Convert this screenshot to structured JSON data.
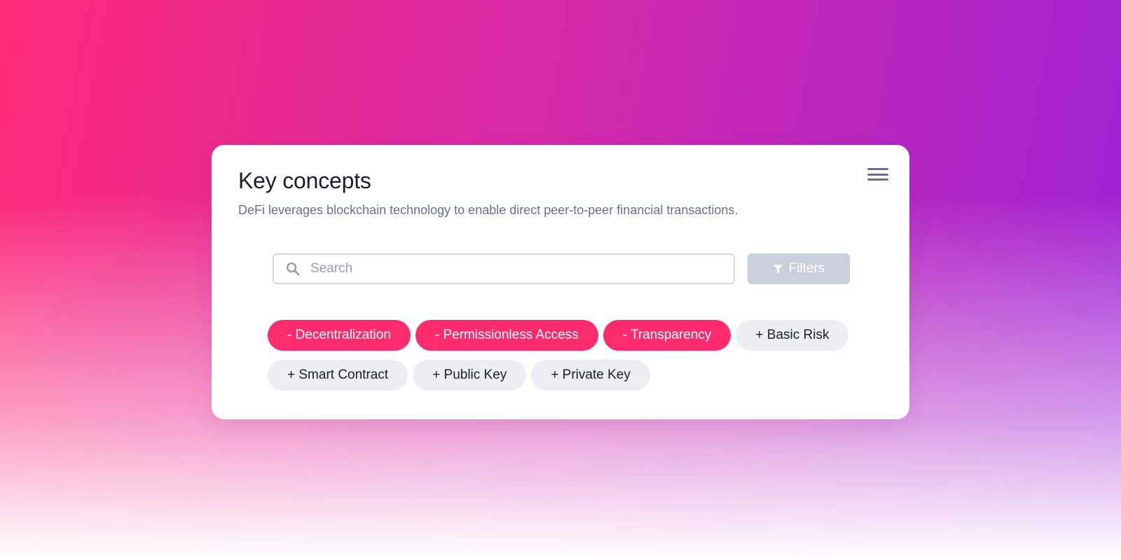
{
  "card": {
    "title": "Key concepts",
    "description": "DeFi leverages blockchain technology to enable direct peer-to-peer financial transactions.",
    "menu_icon": "hamburger-menu-icon"
  },
  "search": {
    "placeholder": "Search",
    "value": "",
    "icon": "search-icon"
  },
  "filters": {
    "label": "Filters",
    "icon": "filter-icon",
    "state": "disabled"
  },
  "tags": {
    "row1": [
      {
        "label": "- Decentralization",
        "active": true
      },
      {
        "label": "- Permissionless Access",
        "active": true
      },
      {
        "label": "- Transparency",
        "active": true
      },
      {
        "label": "+ Basic Risk",
        "active": false
      }
    ],
    "row2": [
      {
        "label": "+ Smart Contract",
        "active": false
      },
      {
        "label": "+ Public Key",
        "active": false
      },
      {
        "label": "+ Private Key",
        "active": false
      }
    ]
  },
  "colors": {
    "active_tag": "#ff2c6f",
    "inactive_tag": "#eceef3",
    "filters_button": "#c9cfdb",
    "gradient_start": "#ff2a78",
    "gradient_end": "#9d22d6"
  }
}
